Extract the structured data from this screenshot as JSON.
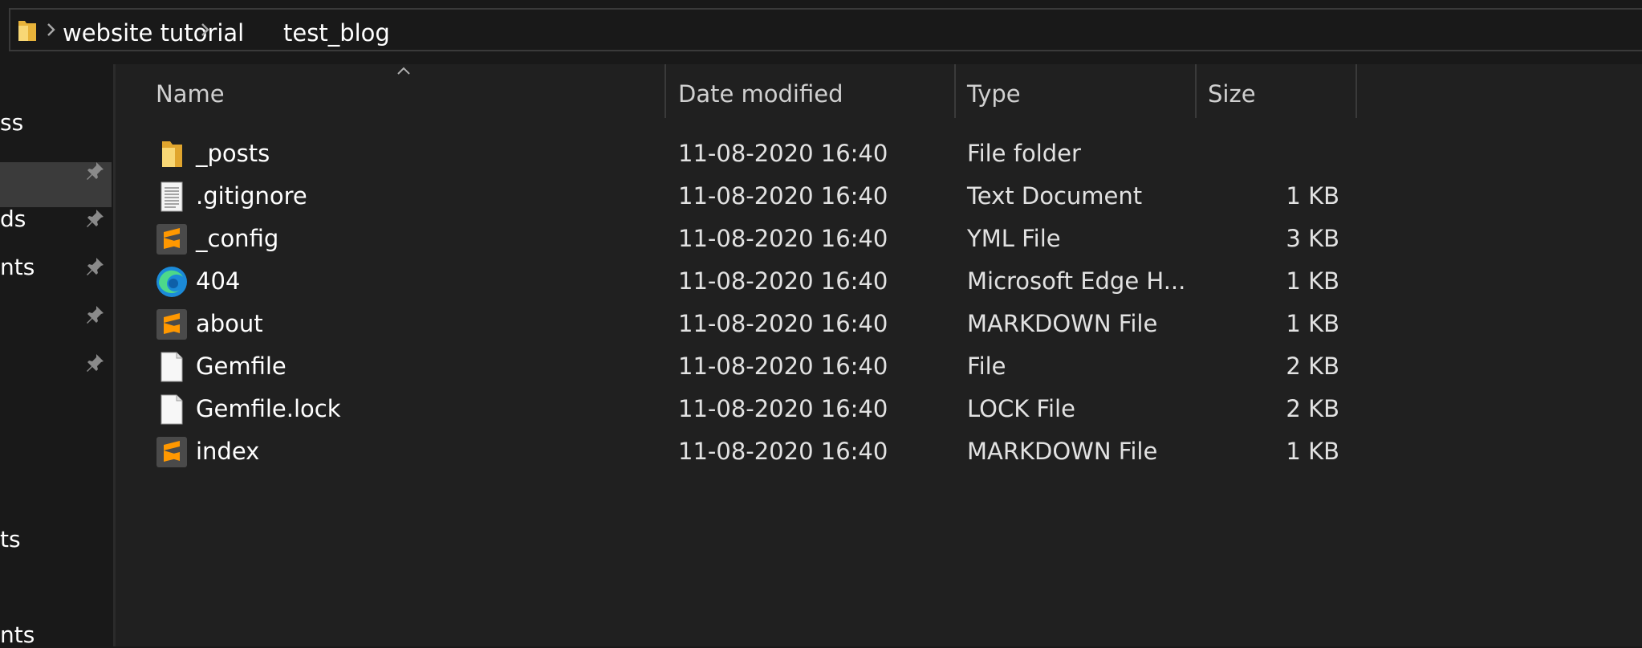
{
  "address_bar": {
    "breadcrumbs": [
      "website tutorial",
      "test_blog"
    ]
  },
  "sidebar": {
    "items": [
      {
        "label": "ss",
        "selected": true,
        "pinned": false
      },
      {
        "label": "",
        "pinned": true
      },
      {
        "label": "ds",
        "pinned": true
      },
      {
        "label": "nts",
        "pinned": true
      },
      {
        "label": "",
        "pinned": true
      },
      {
        "label": "",
        "pinned": true
      },
      {
        "label": "ts",
        "pinned": false
      },
      {
        "label": "nts",
        "pinned": false
      }
    ]
  },
  "file_list": {
    "columns": {
      "name": "Name",
      "date": "Date modified",
      "type": "Type",
      "size": "Size"
    },
    "sort": {
      "column": "name",
      "direction": "ascending"
    },
    "rows": [
      {
        "name": "_posts",
        "date": "11-08-2020 16:40",
        "type": "File folder",
        "size": "",
        "icon": "folder-icon"
      },
      {
        "name": ".gitignore",
        "date": "11-08-2020 16:40",
        "type": "Text Document",
        "size": "1 KB",
        "icon": "text-document-icon"
      },
      {
        "name": "_config",
        "date": "11-08-2020 16:40",
        "type": "YML File",
        "size": "3 KB",
        "icon": "sublime-text-icon"
      },
      {
        "name": "404",
        "date": "11-08-2020 16:40",
        "type": "Microsoft Edge H...",
        "size": "1 KB",
        "icon": "edge-icon"
      },
      {
        "name": "about",
        "date": "11-08-2020 16:40",
        "type": "MARKDOWN File",
        "size": "1 KB",
        "icon": "sublime-text-icon"
      },
      {
        "name": "Gemfile",
        "date": "11-08-2020 16:40",
        "type": "File",
        "size": "2 KB",
        "icon": "blank-file-icon"
      },
      {
        "name": "Gemfile.lock",
        "date": "11-08-2020 16:40",
        "type": "LOCK File",
        "size": "2 KB",
        "icon": "blank-file-icon"
      },
      {
        "name": "index",
        "date": "11-08-2020 16:40",
        "type": "MARKDOWN File",
        "size": "1 KB",
        "icon": "sublime-text-icon"
      }
    ]
  },
  "colors": {
    "background": "#202020",
    "sidebar_background": "#191919",
    "selection": "#3b3b3b",
    "folder_yellow": "#f5c84c",
    "sublime_orange": "#ff9800",
    "edge_blue": "#1b8ad8",
    "edge_green": "#4dd88a"
  }
}
